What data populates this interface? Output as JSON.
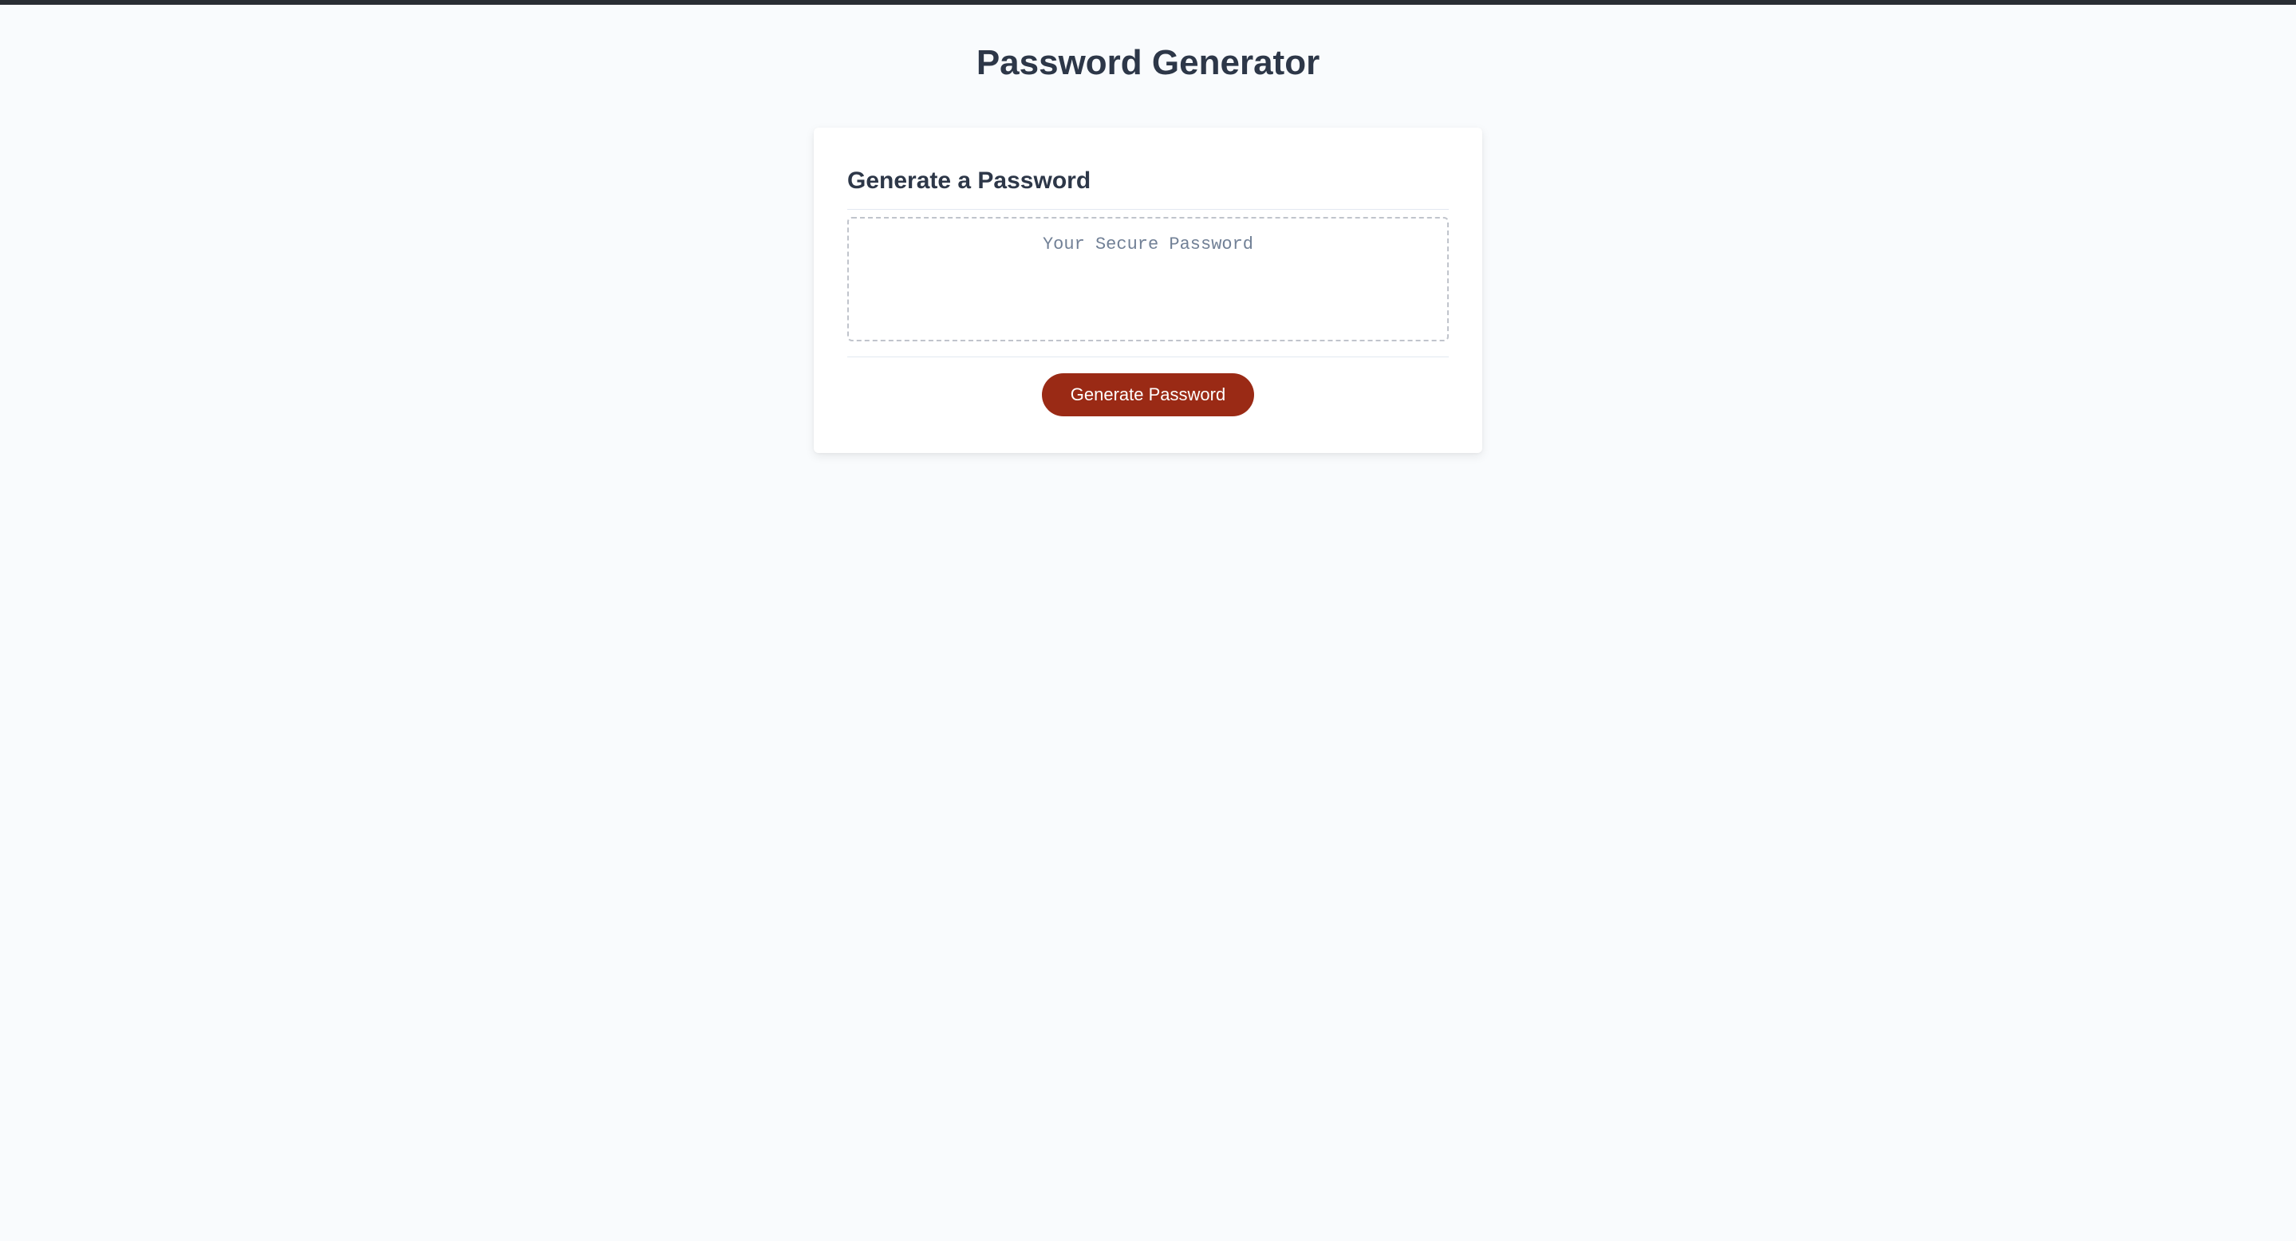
{
  "page": {
    "title": "Password Generator"
  },
  "card": {
    "title": "Generate a Password",
    "output": {
      "placeholder": "Your Secure Password",
      "value": ""
    },
    "button_label": "Generate Password"
  },
  "colors": {
    "accent": "#9a2a15",
    "text_heading": "#2d3748",
    "placeholder": "#718096",
    "page_bg": "#f9fbfd",
    "card_bg": "#ffffff",
    "border": "#e2e8f0",
    "dashed_border": "#c0c4cc",
    "top_bar": "#2a2e34"
  }
}
